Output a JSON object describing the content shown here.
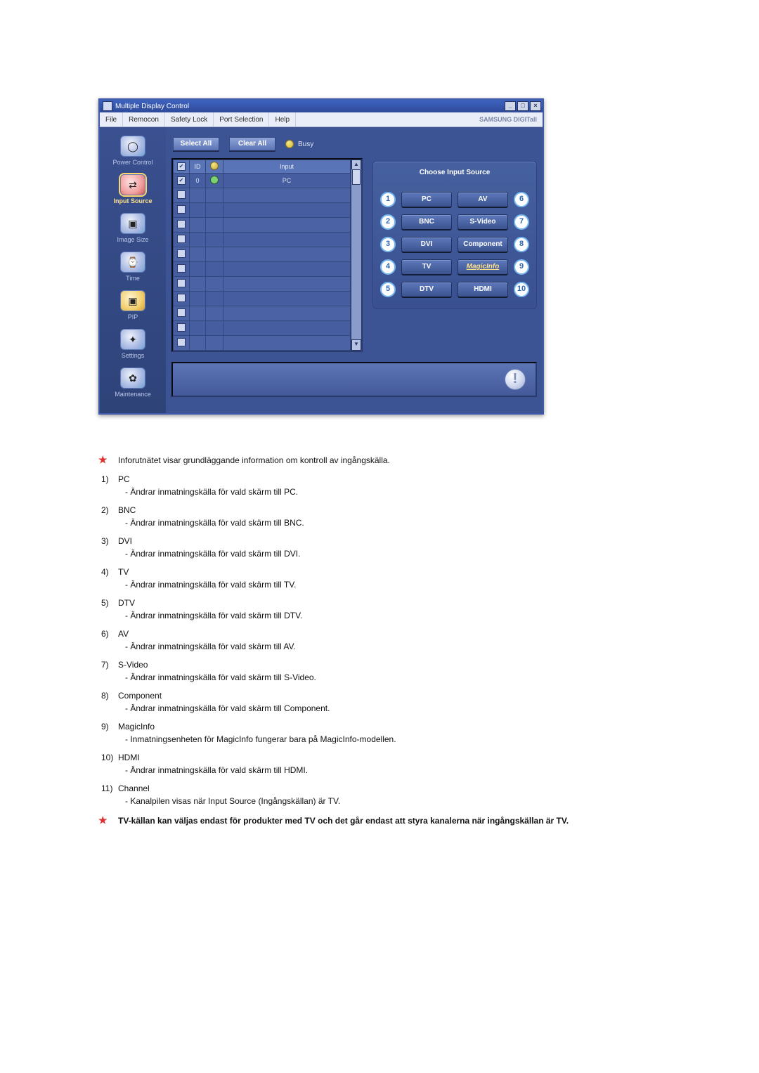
{
  "window": {
    "title": "Multiple Display Control",
    "brand": "SAMSUNG DIGITall"
  },
  "menus": [
    "File",
    "Remocon",
    "Safety Lock",
    "Port Selection",
    "Help"
  ],
  "sidebar": [
    {
      "label": "Power Control",
      "icon": "◯"
    },
    {
      "label": "Input Source",
      "icon": "⇄",
      "active": true,
      "iconStyle": "red"
    },
    {
      "label": "Image Size",
      "icon": "▣"
    },
    {
      "label": "Time",
      "icon": "⌚"
    },
    {
      "label": "PIP",
      "icon": "▣",
      "iconStyle": "yellow"
    },
    {
      "label": "Settings",
      "icon": "✦"
    },
    {
      "label": "Maintenance",
      "icon": "✿"
    }
  ],
  "toolbar": {
    "select_all": "Select All",
    "clear_all": "Clear All",
    "busy": "Busy"
  },
  "table": {
    "headers": {
      "id": "ID",
      "input": "Input"
    },
    "rows": [
      {
        "checked": true,
        "id": "0",
        "led": true,
        "input": "PC"
      },
      {
        "checked": false
      },
      {
        "checked": false
      },
      {
        "checked": false
      },
      {
        "checked": false
      },
      {
        "checked": false
      },
      {
        "checked": false
      },
      {
        "checked": false
      },
      {
        "checked": false
      },
      {
        "checked": false
      },
      {
        "checked": false
      },
      {
        "checked": false
      },
      {
        "checked": false
      }
    ]
  },
  "input_panel": {
    "title": "Choose Input Source",
    "left": [
      {
        "n": "1",
        "label": "PC"
      },
      {
        "n": "2",
        "label": "BNC"
      },
      {
        "n": "3",
        "label": "DVI"
      },
      {
        "n": "4",
        "label": "TV"
      },
      {
        "n": "5",
        "label": "DTV"
      }
    ],
    "right": [
      {
        "n": "6",
        "label": "AV"
      },
      {
        "n": "7",
        "label": "S-Video"
      },
      {
        "n": "8",
        "label": "Component"
      },
      {
        "n": "9",
        "label": "MagicInfo",
        "magic": true
      },
      {
        "n": "10",
        "label": "HDMI"
      }
    ]
  },
  "description": {
    "intro": "Inforutnätet visar grundläggande information om kontroll av ingångskälla.",
    "items": [
      {
        "n": "1)",
        "title": "PC",
        "sub": "- Ändrar inmatningskälla för vald skärm till PC."
      },
      {
        "n": "2)",
        "title": "BNC",
        "sub": "- Ändrar inmatningskälla för vald skärm till BNC."
      },
      {
        "n": "3)",
        "title": "DVI",
        "sub": "- Ändrar inmatningskälla för vald skärm till DVI."
      },
      {
        "n": "4)",
        "title": "TV",
        "sub": "- Ändrar inmatningskälla för vald skärm till TV."
      },
      {
        "n": "5)",
        "title": "DTV",
        "sub": "- Ändrar inmatningskälla för vald skärm till DTV."
      },
      {
        "n": "6)",
        "title": "AV",
        "sub": "- Ändrar inmatningskälla för vald skärm till AV."
      },
      {
        "n": "7)",
        "title": "S-Video",
        "sub": "- Ändrar inmatningskälla för vald skärm till S-Video."
      },
      {
        "n": "8)",
        "title": "Component",
        "sub": "- Ändrar inmatningskälla för vald skärm till Component."
      },
      {
        "n": "9)",
        "title": "MagicInfo",
        "sub": "- Inmatningsenheten för MagicInfo fungerar bara på MagicInfo-modellen."
      },
      {
        "n": "10)",
        "title": "HDMI",
        "sub": "- Ändrar inmatningskälla för vald skärm till HDMI."
      },
      {
        "n": "11)",
        "title": "Channel",
        "sub": "- Kanalpilen visas när Input Source (Ingångskällan) är TV."
      }
    ],
    "footnote": "TV-källan kan väljas endast för produkter med TV och det går endast att styra kanalerna när ingångskällan är TV."
  }
}
